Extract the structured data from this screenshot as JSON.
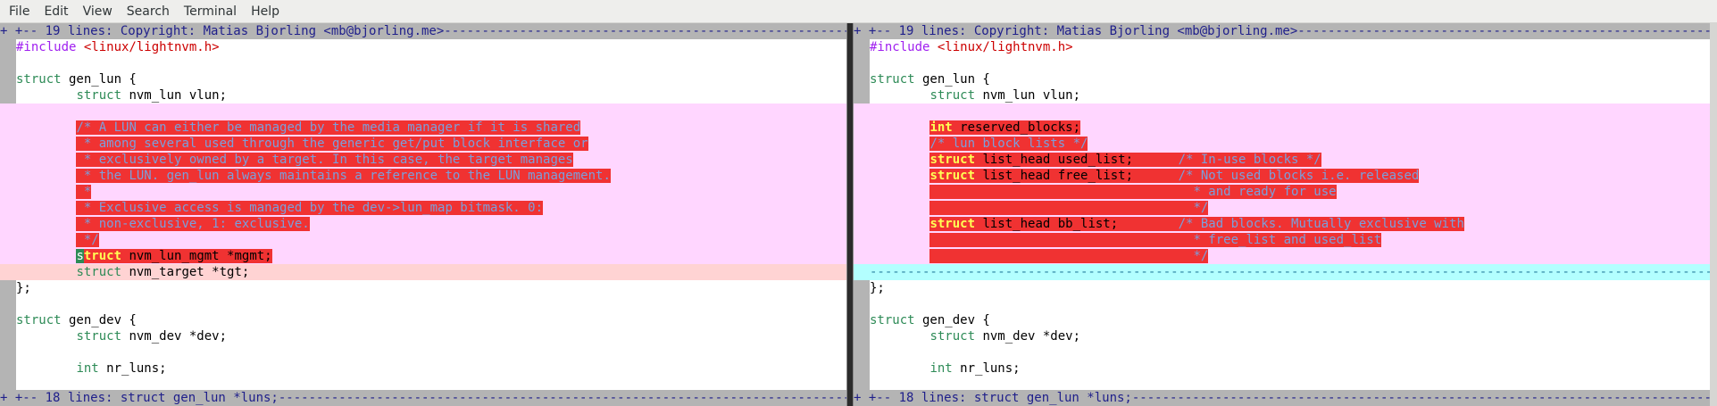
{
  "menu": [
    "File",
    "Edit",
    "View",
    "Search",
    "Terminal",
    "Help"
  ],
  "left": {
    "fold_top": "+ +-- 19 lines: Copyright: Matias Bjorling <mb@bjorling.me>-----------------------------------------------------------------------",
    "fold_bottom": "+ +-- 18 lines: struct gen_lun *luns;--------------------------------------------------------------------------------------------------",
    "lines": [
      {
        "type": "normal",
        "segs": [
          {
            "c": "pp",
            "t": "#include "
          },
          {
            "c": "str",
            "t": "<linux/lightnvm.h>"
          }
        ]
      },
      {
        "type": "normal",
        "segs": []
      },
      {
        "type": "normal",
        "segs": [
          {
            "c": "kw",
            "t": "struct"
          },
          {
            "c": "",
            "t": " gen_lun {"
          }
        ]
      },
      {
        "type": "normal",
        "segs": [
          {
            "c": "",
            "t": "        "
          },
          {
            "c": "kw",
            "t": "struct"
          },
          {
            "c": "",
            "t": " nvm_lun vlun;"
          }
        ]
      },
      {
        "type": "change",
        "segs": []
      },
      {
        "type": "change",
        "segs": [
          {
            "c": "",
            "t": "        "
          },
          {
            "c": "hlcmt",
            "t": "/* A LUN can either be managed by the media manager if it is shared"
          }
        ]
      },
      {
        "type": "change",
        "segs": [
          {
            "c": "",
            "t": "        "
          },
          {
            "c": "hlcmt",
            "t": " * among several used through the generic get/put block interface or"
          }
        ]
      },
      {
        "type": "change",
        "segs": [
          {
            "c": "",
            "t": "        "
          },
          {
            "c": "hlcmt",
            "t": " * exclusively owned by a target. In this case, the target manages"
          }
        ]
      },
      {
        "type": "change",
        "segs": [
          {
            "c": "",
            "t": "        "
          },
          {
            "c": "hlcmt",
            "t": " * the LUN. gen_lun always maintains a reference to the LUN management."
          }
        ]
      },
      {
        "type": "change",
        "segs": [
          {
            "c": "",
            "t": "        "
          },
          {
            "c": "hlcmt",
            "t": " *"
          }
        ]
      },
      {
        "type": "change",
        "segs": [
          {
            "c": "",
            "t": "        "
          },
          {
            "c": "hlcmt",
            "t": " * Exclusive access is managed by the dev->lun_map bitmask. 0:"
          }
        ]
      },
      {
        "type": "change",
        "segs": [
          {
            "c": "",
            "t": "        "
          },
          {
            "c": "hlcmt",
            "t": " * non-exclusive, 1: exclusive."
          }
        ]
      },
      {
        "type": "change",
        "segs": [
          {
            "c": "",
            "t": "        "
          },
          {
            "c": "hlcmt",
            "t": " */"
          }
        ]
      },
      {
        "type": "change",
        "segs": [
          {
            "c": "",
            "t": "        "
          },
          {
            "c": "cursor",
            "t": "s"
          },
          {
            "c": "hlkw",
            "t": "truct"
          },
          {
            "c": "hlplain",
            "t": " nvm_lun_mgmt *mgmt;"
          }
        ]
      },
      {
        "type": "add",
        "segs": [
          {
            "c": "",
            "t": "        "
          },
          {
            "c": "kw",
            "t": "struct"
          },
          {
            "c": "",
            "t": " nvm_target *tgt;"
          }
        ]
      },
      {
        "type": "normal",
        "segs": [
          {
            "c": "",
            "t": "};"
          }
        ]
      },
      {
        "type": "normal",
        "segs": []
      },
      {
        "type": "normal",
        "segs": [
          {
            "c": "kw",
            "t": "struct"
          },
          {
            "c": "",
            "t": " gen_dev {"
          }
        ]
      },
      {
        "type": "normal",
        "segs": [
          {
            "c": "",
            "t": "        "
          },
          {
            "c": "kw",
            "t": "struct"
          },
          {
            "c": "",
            "t": " nvm_dev *dev;"
          }
        ]
      },
      {
        "type": "normal",
        "segs": []
      },
      {
        "type": "normal",
        "segs": [
          {
            "c": "",
            "t": "        "
          },
          {
            "c": "kw",
            "t": "int"
          },
          {
            "c": "",
            "t": " nr_luns;"
          }
        ]
      }
    ]
  },
  "right": {
    "fold_top": "+ +-- 19 lines: Copyright: Matias Bjorling <mb@bjorling.me>-----------------------------------------------------------------------",
    "fold_bottom": "+ +-- 18 lines: struct gen_lun *luns;--------------------------------------------------------------------------------------------------",
    "lines": [
      {
        "type": "normal",
        "segs": [
          {
            "c": "pp",
            "t": "#include "
          },
          {
            "c": "str",
            "t": "<linux/lightnvm.h>"
          }
        ]
      },
      {
        "type": "normal",
        "segs": []
      },
      {
        "type": "normal",
        "segs": [
          {
            "c": "kw",
            "t": "struct"
          },
          {
            "c": "",
            "t": " gen_lun {"
          }
        ]
      },
      {
        "type": "normal",
        "segs": [
          {
            "c": "",
            "t": "        "
          },
          {
            "c": "kw",
            "t": "struct"
          },
          {
            "c": "",
            "t": " nvm_lun vlun;"
          }
        ]
      },
      {
        "type": "change",
        "segs": []
      },
      {
        "type": "change",
        "segs": [
          {
            "c": "",
            "t": "        "
          },
          {
            "c": "hlkw",
            "t": "int"
          },
          {
            "c": "hlplain",
            "t": " reserved_blocks;"
          }
        ]
      },
      {
        "type": "change",
        "segs": [
          {
            "c": "",
            "t": "        "
          },
          {
            "c": "hlcmt",
            "t": "/* lun block lists */"
          }
        ]
      },
      {
        "type": "change",
        "segs": [
          {
            "c": "",
            "t": "        "
          },
          {
            "c": "hlkw",
            "t": "struct"
          },
          {
            "c": "hlplain",
            "t": " list_head used_list;      "
          },
          {
            "c": "hlcmt",
            "t": "/* In-use blocks */"
          }
        ]
      },
      {
        "type": "change",
        "segs": [
          {
            "c": "",
            "t": "        "
          },
          {
            "c": "hlkw",
            "t": "struct"
          },
          {
            "c": "hlplain",
            "t": " list_head free_list;      "
          },
          {
            "c": "hlcmt",
            "t": "/* Not used blocks i.e. released"
          }
        ]
      },
      {
        "type": "change",
        "segs": [
          {
            "c": "",
            "t": "        "
          },
          {
            "c": "hlplain",
            "t": "                                  "
          },
          {
            "c": "hlcmt",
            "t": " * and ready for use"
          }
        ]
      },
      {
        "type": "change",
        "segs": [
          {
            "c": "",
            "t": "        "
          },
          {
            "c": "hlplain",
            "t": "                                  "
          },
          {
            "c": "hlcmt",
            "t": " */"
          }
        ]
      },
      {
        "type": "change",
        "segs": [
          {
            "c": "",
            "t": "        "
          },
          {
            "c": "hlkw",
            "t": "struct"
          },
          {
            "c": "hlplain",
            "t": " list_head bb_list;        "
          },
          {
            "c": "hlcmt",
            "t": "/* Bad blocks. Mutually exclusive with"
          }
        ]
      },
      {
        "type": "change",
        "segs": [
          {
            "c": "",
            "t": "        "
          },
          {
            "c": "hlplain",
            "t": "                                  "
          },
          {
            "c": "hlcmt",
            "t": " * free_list and used_list"
          }
        ]
      },
      {
        "type": "change",
        "segs": [
          {
            "c": "",
            "t": "        "
          },
          {
            "c": "hlplain",
            "t": "                                  "
          },
          {
            "c": "hlcmt",
            "t": " */"
          }
        ]
      },
      {
        "type": "filler",
        "segs": [
          {
            "c": "",
            "t": "---------------------------------------------------------------------------------------------------------------------------------------------------"
          }
        ]
      },
      {
        "type": "normal",
        "segs": [
          {
            "c": "",
            "t": "};"
          }
        ]
      },
      {
        "type": "normal",
        "segs": []
      },
      {
        "type": "normal",
        "segs": [
          {
            "c": "kw",
            "t": "struct"
          },
          {
            "c": "",
            "t": " gen_dev {"
          }
        ]
      },
      {
        "type": "normal",
        "segs": [
          {
            "c": "",
            "t": "        "
          },
          {
            "c": "kw",
            "t": "struct"
          },
          {
            "c": "",
            "t": " nvm_dev *dev;"
          }
        ]
      },
      {
        "type": "normal",
        "segs": []
      },
      {
        "type": "normal",
        "segs": [
          {
            "c": "",
            "t": "        "
          },
          {
            "c": "kw",
            "t": "int"
          },
          {
            "c": "",
            "t": " nr_luns;"
          }
        ]
      }
    ]
  }
}
